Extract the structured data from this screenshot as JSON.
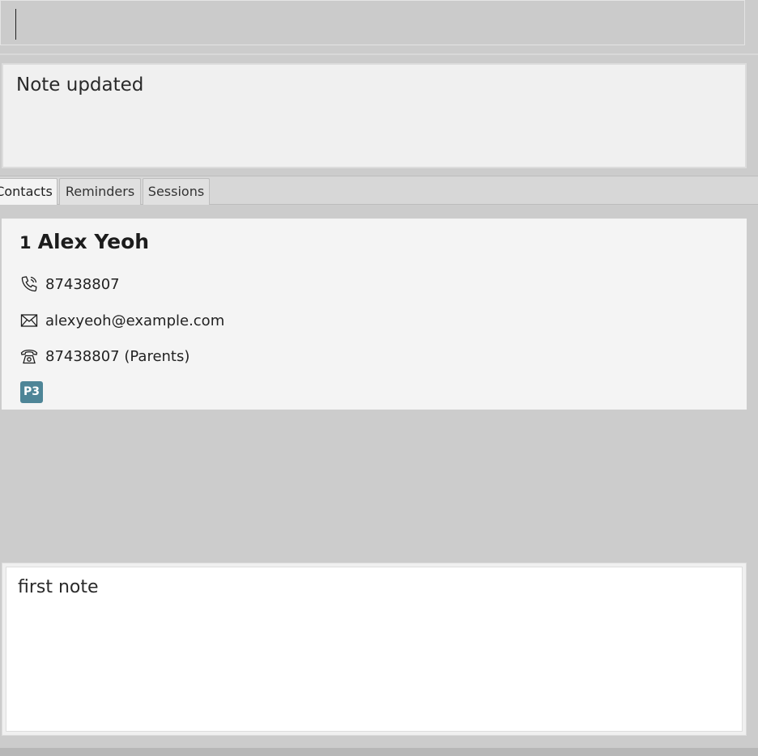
{
  "command_box": {
    "value": "",
    "placeholder": ""
  },
  "result_display": {
    "text": "Note updated"
  },
  "tabs": [
    {
      "label": "Contacts",
      "active": true
    },
    {
      "label": "Reminders",
      "active": false
    },
    {
      "label": "Sessions",
      "active": false
    }
  ],
  "contacts": [
    {
      "index": "1",
      "name": "Alex Yeoh",
      "phone": "87438807",
      "email": "alexyeoh@example.com",
      "parent_phone": "87438807 (Parents)",
      "tags": [
        "P3"
      ],
      "icons": {
        "phone": "phone-icon",
        "email": "envelope-icon",
        "parent_phone": "telephone-icon"
      }
    }
  ],
  "note_panel": {
    "text": "first note"
  },
  "colors": {
    "tag_bg": "#4e8597",
    "background": "#cccccc",
    "card_bg": "#f4f4f4"
  }
}
